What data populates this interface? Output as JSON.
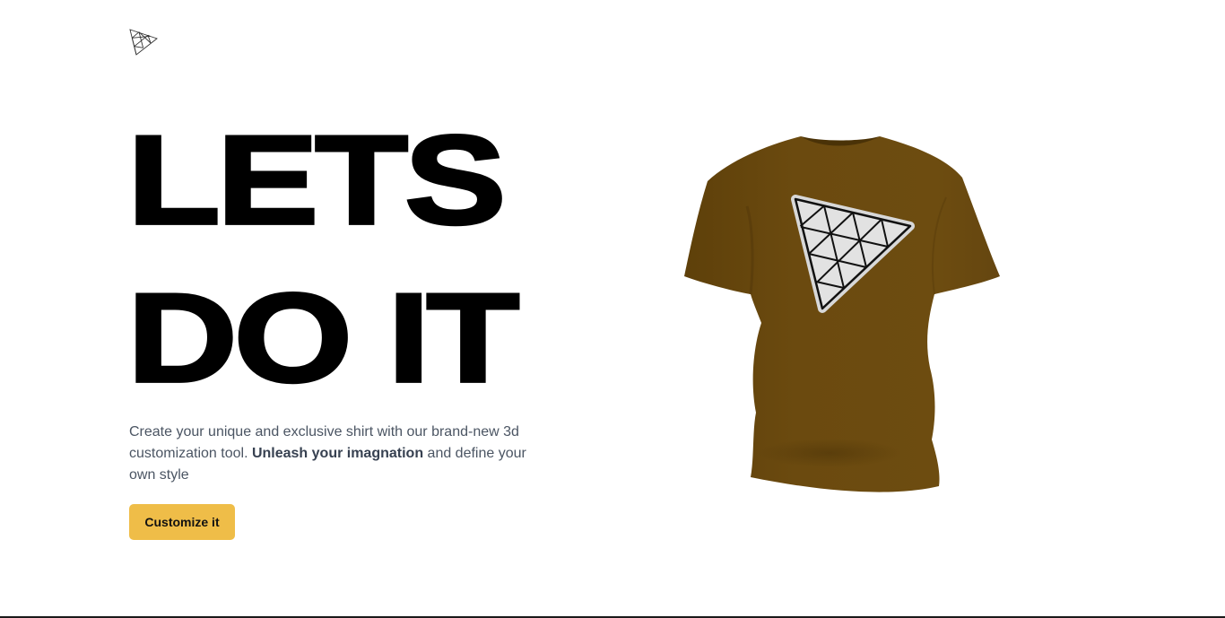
{
  "brand": {
    "logo_icon": "triangle-mesh-logo-icon"
  },
  "hero": {
    "headline_line1": "LETS",
    "headline_line2": "DO IT",
    "description_part1": "Create your unique and exclusive shirt with our brand-new 3d customization tool. ",
    "description_bold": "Unleash your imagnation",
    "description_part2": " and define your own style",
    "cta_label": "Customize it"
  },
  "product": {
    "shirt_color": "#6b4a0f",
    "decal_icon": "triangle-mesh-decal-icon",
    "decal_fill": "#e2e2e2"
  },
  "colors": {
    "accent": "#efbd48",
    "text_primary": "#000000",
    "text_secondary": "#4b5563"
  }
}
